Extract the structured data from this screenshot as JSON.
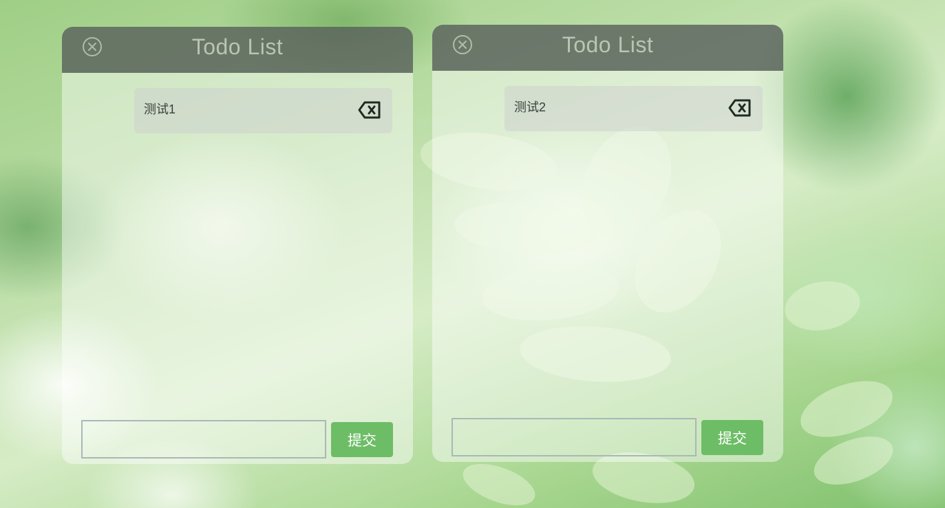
{
  "colors": {
    "header_bg": "#28302d",
    "submit_bg": "#6dbd66",
    "item_bg": "#cdd2cd",
    "input_border": "#a8b8b8",
    "title_text": "#c8d2be"
  },
  "lists": [
    {
      "title": "Todo List",
      "close_icon": "close-circle-icon",
      "items": [
        {
          "text": "测试1",
          "delete_icon": "backspace-delete-icon"
        }
      ],
      "input": {
        "value": "",
        "placeholder": ""
      },
      "submit_label": "提交"
    },
    {
      "title": "Todo List",
      "close_icon": "close-circle-icon",
      "items": [
        {
          "text": "测试2",
          "delete_icon": "backspace-delete-icon"
        }
      ],
      "input": {
        "value": "",
        "placeholder": ""
      },
      "submit_label": "提交"
    }
  ]
}
